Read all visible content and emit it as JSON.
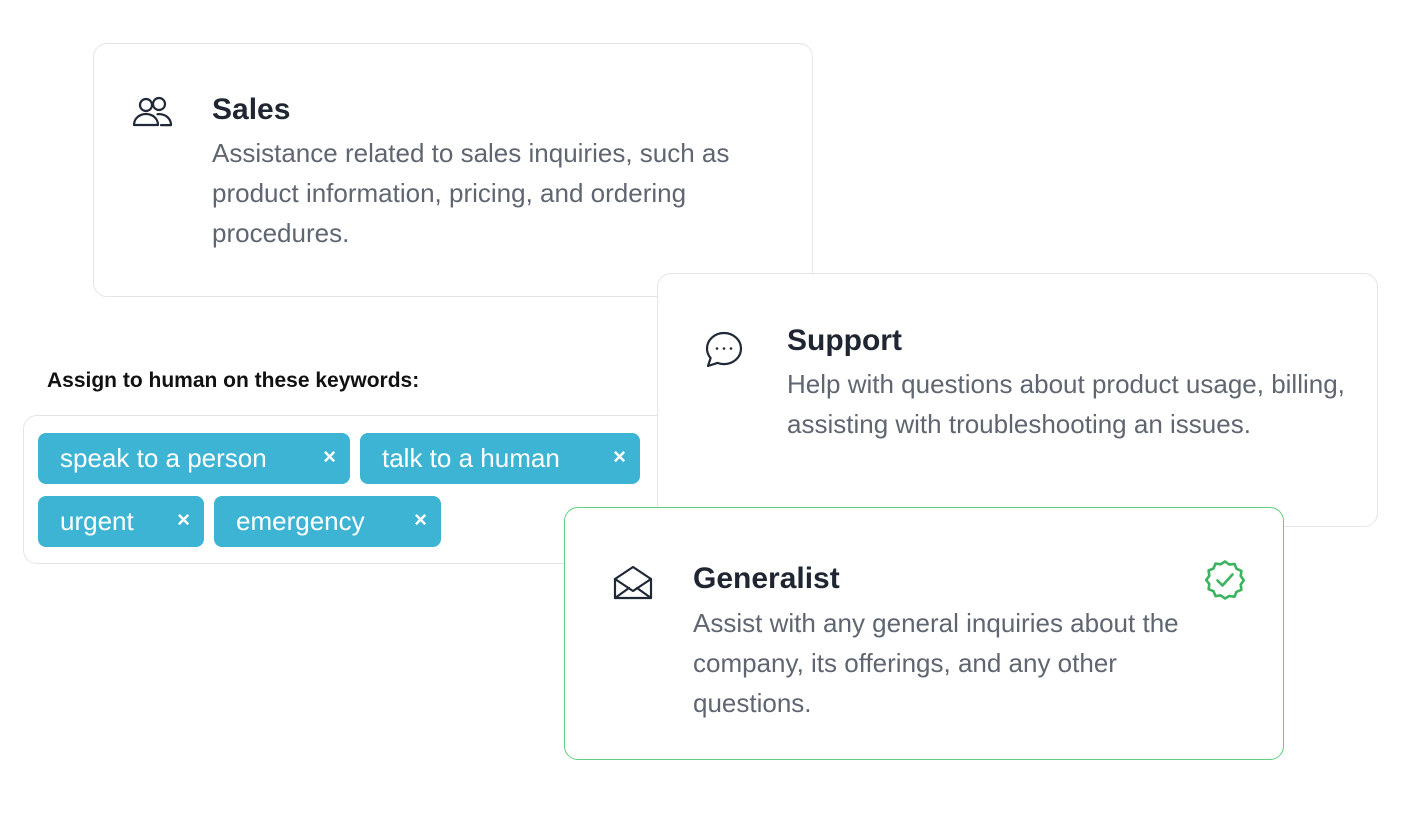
{
  "cards": [
    {
      "id": "sales",
      "icon": "users-icon",
      "title": "Sales",
      "description": "Assistance related to sales inquiries, such as product information, pricing, and ordering procedures.",
      "selected": false
    },
    {
      "id": "support",
      "icon": "chat-bubble-icon",
      "title": "Support",
      "description": "Help with questions about product usage, billing, assisting with troubleshooting an issues.",
      "selected": false
    },
    {
      "id": "generalist",
      "icon": "envelope-open-icon",
      "title": "Generalist",
      "description": "Assist with any general inquiries about the company, its offerings, and any other questions.",
      "selected": true,
      "selected_icon": "check-badge-icon"
    }
  ],
  "keywords": {
    "heading": "Assign to human on these keywords:",
    "tags": [
      {
        "label": "speak to a person",
        "remove": "×"
      },
      {
        "label": "talk to a human",
        "remove": "×"
      },
      {
        "label": "urgent",
        "remove": "×"
      },
      {
        "label": "emergency",
        "remove": "×"
      }
    ]
  },
  "colors": {
    "tag_background": "#3db4d3",
    "selected_border": "#5fcf7f",
    "check_badge": "#3ab45e",
    "title_text": "#1f2632",
    "description_text": "#5f6672"
  }
}
